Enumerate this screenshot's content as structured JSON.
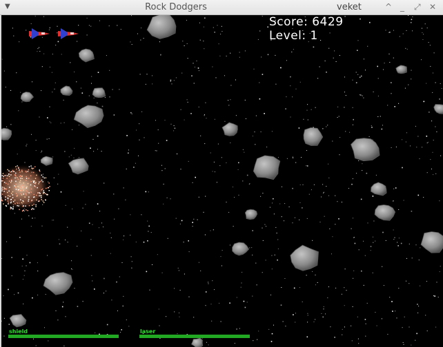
{
  "window": {
    "title": "Rock Dodgers",
    "host": "veket",
    "menu_icon": "triangle-down-icon",
    "controls": [
      "^",
      "_",
      "⤢",
      "✕"
    ]
  },
  "hud": {
    "score_text": "Score: 6429",
    "level_text": "Level: 1",
    "lives": 2
  },
  "status": {
    "shield_label": "shield",
    "shield_level": 1.0,
    "laser_label": "laser",
    "laser_level": 1.0
  },
  "colors": {
    "background": "#000000",
    "rock": "#8a8a8a",
    "bar_fill": "#22a822",
    "label": "#28e028",
    "ship_red": "#e03030",
    "ship_blue": "#3040d0"
  }
}
